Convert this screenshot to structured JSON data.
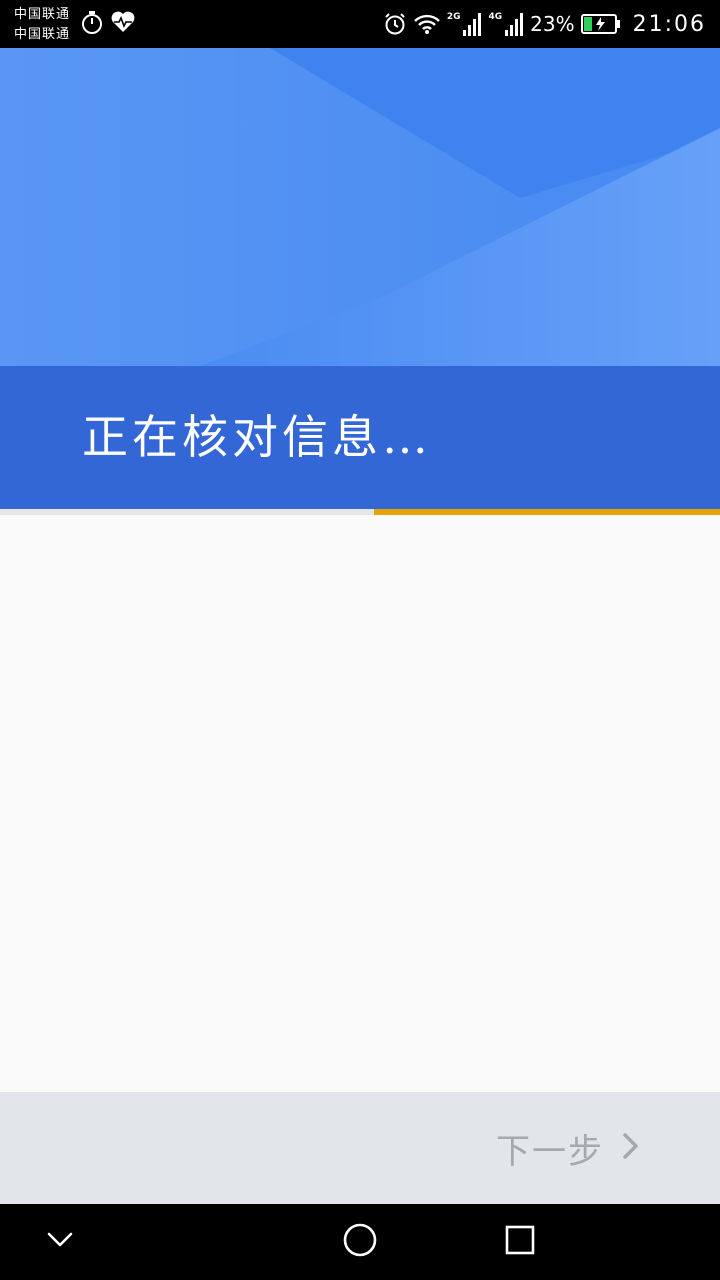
{
  "status_bar": {
    "carrier_1": "中国联通",
    "carrier_2": "中国联通",
    "network_1": "2G",
    "network_2": "4G",
    "battery_percent": "23%",
    "time": "21:06",
    "icons": [
      "stopwatch-icon",
      "heart-rate-icon",
      "alarm-icon",
      "wifi-icon",
      "signal-icon",
      "signal-icon",
      "battery-charging-icon"
    ]
  },
  "header": {
    "title": "正在核对信息…",
    "colors": {
      "top": "#4689f1",
      "band": "#3367d6"
    }
  },
  "progress": {
    "fraction": 0.48,
    "fill_color": "#e5a50a",
    "track_color": "#e6e6e6"
  },
  "footer": {
    "next_label": "下一步",
    "next_icon": "chevron-right-icon",
    "disabled_color": "#a5a9ad"
  },
  "navigation": {
    "icons": [
      "chevron-down-icon",
      "home-circle-icon",
      "recents-square-icon"
    ]
  }
}
